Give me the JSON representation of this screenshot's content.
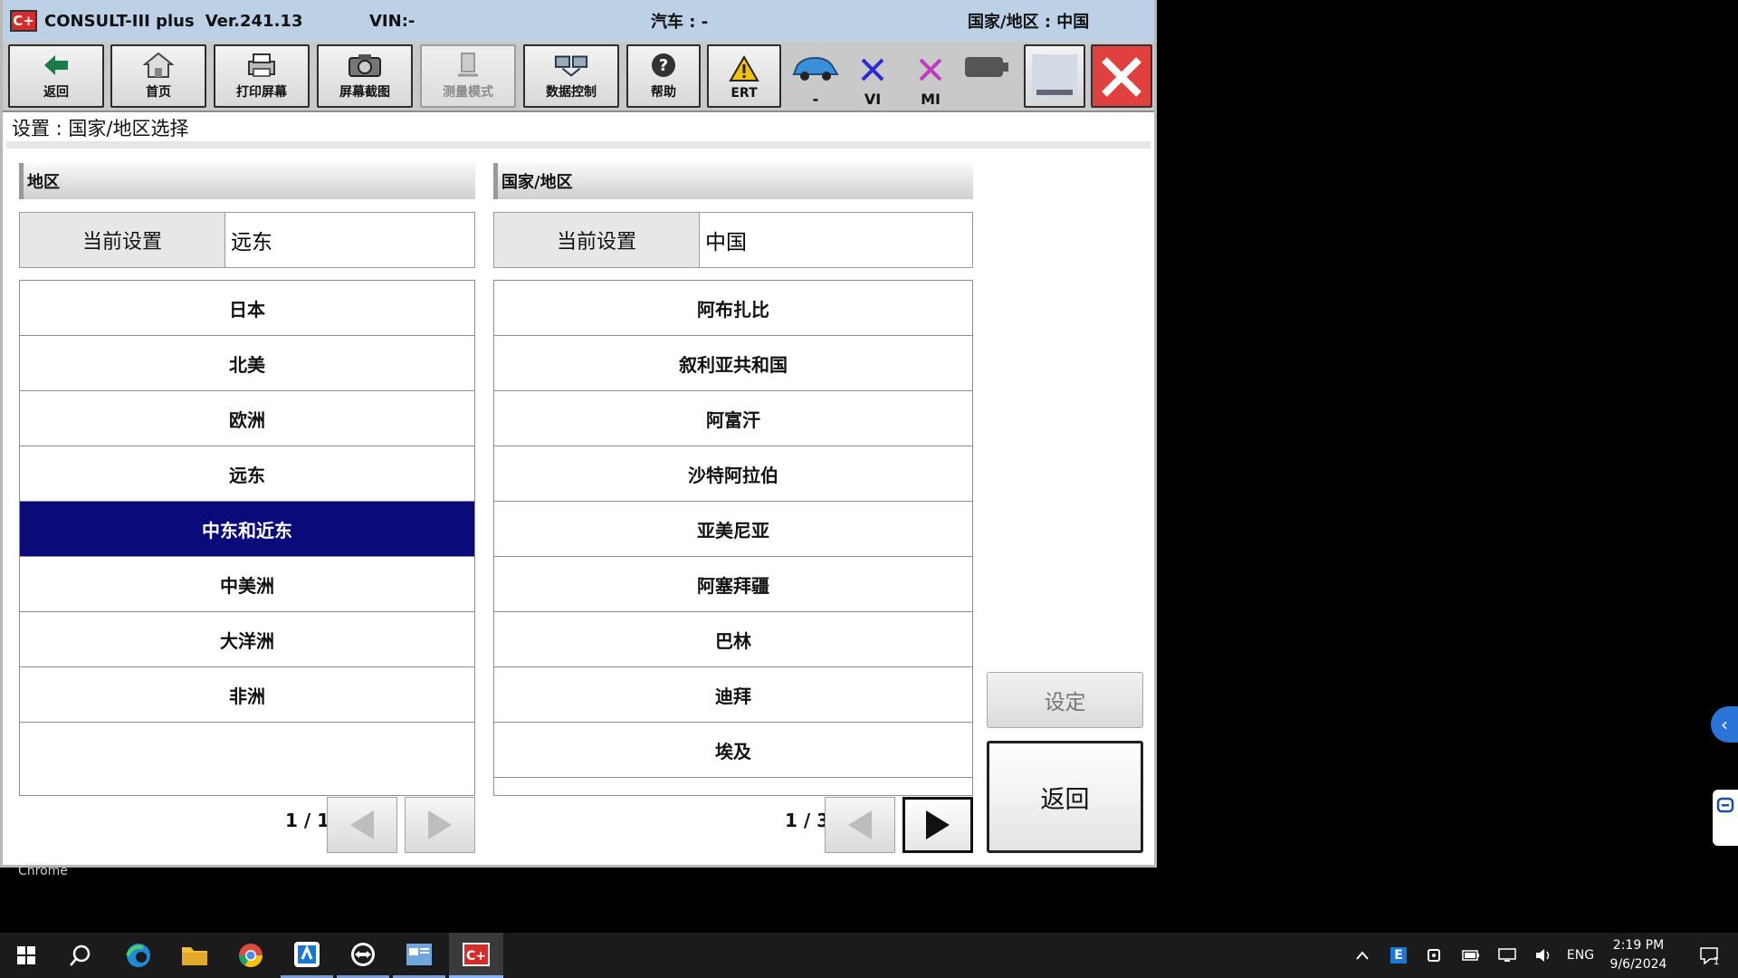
{
  "titlebar": {
    "app_name": "CONSULT-III plus",
    "version": "Ver.241.13",
    "vin": "VIN:-",
    "car": "汽车 : -",
    "region": "国家/地区 : 中国",
    "logo": "C+"
  },
  "toolbar": {
    "back": "返回",
    "home": "首页",
    "print": "打印屏幕",
    "screenshot": "屏幕截图",
    "measure": "测量模式",
    "data_control": "数据控制",
    "help": "帮助",
    "ert": "ERT",
    "car_status": "-",
    "vi": "VI",
    "mi": "MI"
  },
  "breadcrumb": "设置 : 国家/地区选择",
  "region_panel": {
    "header": "地区",
    "current_label": "当前设置",
    "current_value": "远东",
    "items": [
      "日本",
      "北美",
      "欧洲",
      "远东",
      "中东和近东",
      "中美洲",
      "大洋洲",
      "非洲"
    ],
    "selected_index": 4,
    "page": "1 / 1"
  },
  "country_panel": {
    "header": "国家/地区",
    "current_label": "当前设置",
    "current_value": "中国",
    "items": [
      "阿布扎比",
      "叙利亚共和国",
      "阿富汗",
      "沙特阿拉伯",
      "亚美尼亚",
      "阿塞拜疆",
      "巴林",
      "迪拜",
      "埃及"
    ],
    "page": "1 / 3"
  },
  "actions": {
    "set": "设定",
    "back": "返回"
  },
  "chrome_label": "Chrome",
  "taskbar": {
    "lang": "ENG",
    "time": "2:19 PM",
    "date": "9/6/2024",
    "notifications": "1",
    "tray_e": "E"
  },
  "colors": {
    "selected_row": "#0a0a7a",
    "titlebar": "#bcd0e6",
    "close_red": "#e0413e"
  }
}
